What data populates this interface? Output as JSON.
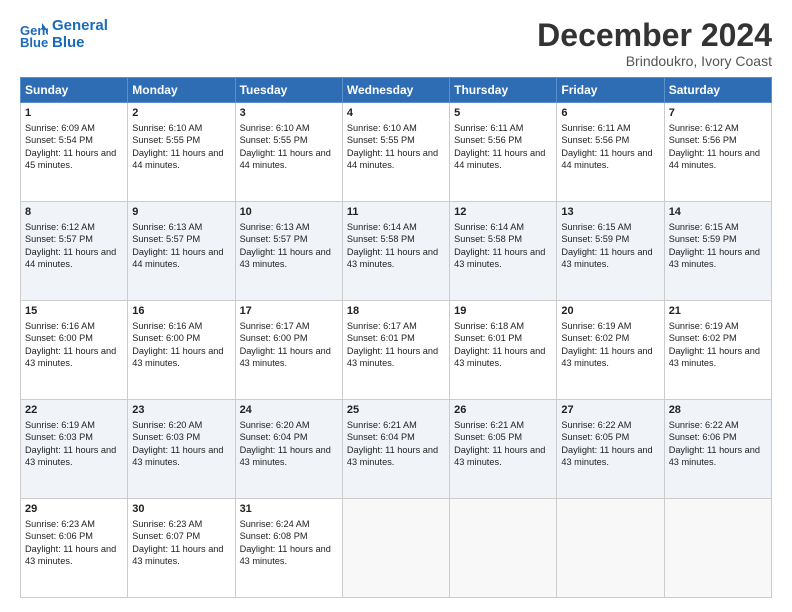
{
  "header": {
    "logo_line1": "General",
    "logo_line2": "Blue",
    "month": "December 2024",
    "location": "Brindoukro, Ivory Coast"
  },
  "days_of_week": [
    "Sunday",
    "Monday",
    "Tuesday",
    "Wednesday",
    "Thursday",
    "Friday",
    "Saturday"
  ],
  "weeks": [
    [
      {
        "day": "1",
        "info": "Sunrise: 6:09 AM\nSunset: 5:54 PM\nDaylight: 11 hours and 45 minutes."
      },
      {
        "day": "2",
        "info": "Sunrise: 6:10 AM\nSunset: 5:55 PM\nDaylight: 11 hours and 44 minutes."
      },
      {
        "day": "3",
        "info": "Sunrise: 6:10 AM\nSunset: 5:55 PM\nDaylight: 11 hours and 44 minutes."
      },
      {
        "day": "4",
        "info": "Sunrise: 6:10 AM\nSunset: 5:55 PM\nDaylight: 11 hours and 44 minutes."
      },
      {
        "day": "5",
        "info": "Sunrise: 6:11 AM\nSunset: 5:56 PM\nDaylight: 11 hours and 44 minutes."
      },
      {
        "day": "6",
        "info": "Sunrise: 6:11 AM\nSunset: 5:56 PM\nDaylight: 11 hours and 44 minutes."
      },
      {
        "day": "7",
        "info": "Sunrise: 6:12 AM\nSunset: 5:56 PM\nDaylight: 11 hours and 44 minutes."
      }
    ],
    [
      {
        "day": "8",
        "info": "Sunrise: 6:12 AM\nSunset: 5:57 PM\nDaylight: 11 hours and 44 minutes."
      },
      {
        "day": "9",
        "info": "Sunrise: 6:13 AM\nSunset: 5:57 PM\nDaylight: 11 hours and 44 minutes."
      },
      {
        "day": "10",
        "info": "Sunrise: 6:13 AM\nSunset: 5:57 PM\nDaylight: 11 hours and 43 minutes."
      },
      {
        "day": "11",
        "info": "Sunrise: 6:14 AM\nSunset: 5:58 PM\nDaylight: 11 hours and 43 minutes."
      },
      {
        "day": "12",
        "info": "Sunrise: 6:14 AM\nSunset: 5:58 PM\nDaylight: 11 hours and 43 minutes."
      },
      {
        "day": "13",
        "info": "Sunrise: 6:15 AM\nSunset: 5:59 PM\nDaylight: 11 hours and 43 minutes."
      },
      {
        "day": "14",
        "info": "Sunrise: 6:15 AM\nSunset: 5:59 PM\nDaylight: 11 hours and 43 minutes."
      }
    ],
    [
      {
        "day": "15",
        "info": "Sunrise: 6:16 AM\nSunset: 6:00 PM\nDaylight: 11 hours and 43 minutes."
      },
      {
        "day": "16",
        "info": "Sunrise: 6:16 AM\nSunset: 6:00 PM\nDaylight: 11 hours and 43 minutes."
      },
      {
        "day": "17",
        "info": "Sunrise: 6:17 AM\nSunset: 6:00 PM\nDaylight: 11 hours and 43 minutes."
      },
      {
        "day": "18",
        "info": "Sunrise: 6:17 AM\nSunset: 6:01 PM\nDaylight: 11 hours and 43 minutes."
      },
      {
        "day": "19",
        "info": "Sunrise: 6:18 AM\nSunset: 6:01 PM\nDaylight: 11 hours and 43 minutes."
      },
      {
        "day": "20",
        "info": "Sunrise: 6:19 AM\nSunset: 6:02 PM\nDaylight: 11 hours and 43 minutes."
      },
      {
        "day": "21",
        "info": "Sunrise: 6:19 AM\nSunset: 6:02 PM\nDaylight: 11 hours and 43 minutes."
      }
    ],
    [
      {
        "day": "22",
        "info": "Sunrise: 6:19 AM\nSunset: 6:03 PM\nDaylight: 11 hours and 43 minutes."
      },
      {
        "day": "23",
        "info": "Sunrise: 6:20 AM\nSunset: 6:03 PM\nDaylight: 11 hours and 43 minutes."
      },
      {
        "day": "24",
        "info": "Sunrise: 6:20 AM\nSunset: 6:04 PM\nDaylight: 11 hours and 43 minutes."
      },
      {
        "day": "25",
        "info": "Sunrise: 6:21 AM\nSunset: 6:04 PM\nDaylight: 11 hours and 43 minutes."
      },
      {
        "day": "26",
        "info": "Sunrise: 6:21 AM\nSunset: 6:05 PM\nDaylight: 11 hours and 43 minutes."
      },
      {
        "day": "27",
        "info": "Sunrise: 6:22 AM\nSunset: 6:05 PM\nDaylight: 11 hours and 43 minutes."
      },
      {
        "day": "28",
        "info": "Sunrise: 6:22 AM\nSunset: 6:06 PM\nDaylight: 11 hours and 43 minutes."
      }
    ],
    [
      {
        "day": "29",
        "info": "Sunrise: 6:23 AM\nSunset: 6:06 PM\nDaylight: 11 hours and 43 minutes."
      },
      {
        "day": "30",
        "info": "Sunrise: 6:23 AM\nSunset: 6:07 PM\nDaylight: 11 hours and 43 minutes."
      },
      {
        "day": "31",
        "info": "Sunrise: 6:24 AM\nSunset: 6:08 PM\nDaylight: 11 hours and 43 minutes."
      },
      {
        "day": "",
        "info": ""
      },
      {
        "day": "",
        "info": ""
      },
      {
        "day": "",
        "info": ""
      },
      {
        "day": "",
        "info": ""
      }
    ]
  ]
}
